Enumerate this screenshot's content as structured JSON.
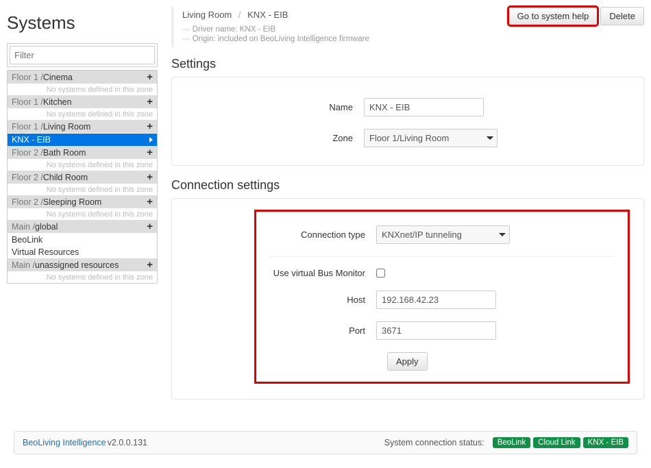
{
  "sidebar": {
    "title": "Systems",
    "filter_placeholder": "Filter",
    "empty_note": "No systems defined in this zone",
    "zones": [
      {
        "floor": "Floor 1 / ",
        "name": "Cinema",
        "empty": true,
        "systems": []
      },
      {
        "floor": "Floor 1 / ",
        "name": "Kitchen",
        "empty": true,
        "systems": []
      },
      {
        "floor": "Floor 1 / ",
        "name": "Living Room",
        "empty": false,
        "systems": [
          {
            "name": "KNX - EIB",
            "selected": true
          }
        ]
      },
      {
        "floor": "Floor 2 / ",
        "name": "Bath Room",
        "empty": true,
        "systems": []
      },
      {
        "floor": "Floor 2 / ",
        "name": "Child Room",
        "empty": true,
        "systems": []
      },
      {
        "floor": "Floor 2 / ",
        "name": "Sleeping Room",
        "empty": true,
        "systems": []
      },
      {
        "floor": "Main / ",
        "name": "global",
        "empty": false,
        "systems": [
          {
            "name": "BeoLink",
            "selected": false
          },
          {
            "name": "Virtual Resources",
            "selected": false
          }
        ]
      },
      {
        "floor": "Main / ",
        "name": "unassigned resources",
        "empty": true,
        "systems": []
      }
    ]
  },
  "header": {
    "breadcrumb": [
      "Living Room",
      "KNX - EIB"
    ],
    "meta_driver": "Driver name: KNX - EIB",
    "meta_origin": "Origin: included on BeoLiving Intelligence firmware",
    "help_button": "Go to system help",
    "delete_button": "Delete"
  },
  "settings": {
    "section_title": "Settings",
    "name_label": "Name",
    "name_value": "KNX - EIB",
    "zone_label": "Zone",
    "zone_value": "Floor 1/Living Room"
  },
  "connection": {
    "section_title": "Connection settings",
    "type_label": "Connection type",
    "type_value": "KNXnet/IP tunneling",
    "vbus_label": "Use virtual Bus Monitor",
    "vbus_checked": false,
    "host_label": "Host",
    "host_value": "192.168.42.23",
    "port_label": "Port",
    "port_value": "3671",
    "apply_label": "Apply"
  },
  "footer": {
    "brand": "BeoLiving Intelligence",
    "version": " v2.0.0.131",
    "status_label": "System connection status:",
    "badges": [
      "BeoLink",
      "Cloud Link",
      "KNX - EIB"
    ]
  }
}
